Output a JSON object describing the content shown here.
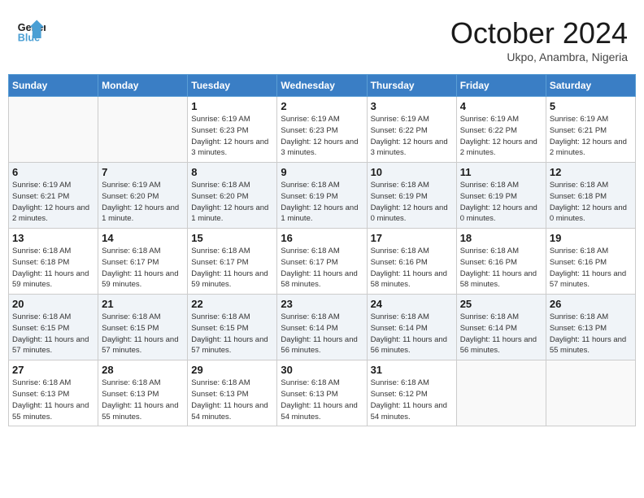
{
  "header": {
    "logo_line1": "General",
    "logo_line2": "Blue",
    "month": "October 2024",
    "location": "Ukpo, Anambra, Nigeria"
  },
  "weekdays": [
    "Sunday",
    "Monday",
    "Tuesday",
    "Wednesday",
    "Thursday",
    "Friday",
    "Saturday"
  ],
  "weeks": [
    [
      {
        "day": "",
        "info": ""
      },
      {
        "day": "",
        "info": ""
      },
      {
        "day": "1",
        "info": "Sunrise: 6:19 AM\nSunset: 6:23 PM\nDaylight: 12 hours\nand 3 minutes."
      },
      {
        "day": "2",
        "info": "Sunrise: 6:19 AM\nSunset: 6:23 PM\nDaylight: 12 hours\nand 3 minutes."
      },
      {
        "day": "3",
        "info": "Sunrise: 6:19 AM\nSunset: 6:22 PM\nDaylight: 12 hours\nand 3 minutes."
      },
      {
        "day": "4",
        "info": "Sunrise: 6:19 AM\nSunset: 6:22 PM\nDaylight: 12 hours\nand 2 minutes."
      },
      {
        "day": "5",
        "info": "Sunrise: 6:19 AM\nSunset: 6:21 PM\nDaylight: 12 hours\nand 2 minutes."
      }
    ],
    [
      {
        "day": "6",
        "info": "Sunrise: 6:19 AM\nSunset: 6:21 PM\nDaylight: 12 hours\nand 2 minutes."
      },
      {
        "day": "7",
        "info": "Sunrise: 6:19 AM\nSunset: 6:20 PM\nDaylight: 12 hours\nand 1 minute."
      },
      {
        "day": "8",
        "info": "Sunrise: 6:18 AM\nSunset: 6:20 PM\nDaylight: 12 hours\nand 1 minute."
      },
      {
        "day": "9",
        "info": "Sunrise: 6:18 AM\nSunset: 6:19 PM\nDaylight: 12 hours\nand 1 minute."
      },
      {
        "day": "10",
        "info": "Sunrise: 6:18 AM\nSunset: 6:19 PM\nDaylight: 12 hours\nand 0 minutes."
      },
      {
        "day": "11",
        "info": "Sunrise: 6:18 AM\nSunset: 6:19 PM\nDaylight: 12 hours\nand 0 minutes."
      },
      {
        "day": "12",
        "info": "Sunrise: 6:18 AM\nSunset: 6:18 PM\nDaylight: 12 hours\nand 0 minutes."
      }
    ],
    [
      {
        "day": "13",
        "info": "Sunrise: 6:18 AM\nSunset: 6:18 PM\nDaylight: 11 hours\nand 59 minutes."
      },
      {
        "day": "14",
        "info": "Sunrise: 6:18 AM\nSunset: 6:17 PM\nDaylight: 11 hours\nand 59 minutes."
      },
      {
        "day": "15",
        "info": "Sunrise: 6:18 AM\nSunset: 6:17 PM\nDaylight: 11 hours\nand 59 minutes."
      },
      {
        "day": "16",
        "info": "Sunrise: 6:18 AM\nSunset: 6:17 PM\nDaylight: 11 hours\nand 58 minutes."
      },
      {
        "day": "17",
        "info": "Sunrise: 6:18 AM\nSunset: 6:16 PM\nDaylight: 11 hours\nand 58 minutes."
      },
      {
        "day": "18",
        "info": "Sunrise: 6:18 AM\nSunset: 6:16 PM\nDaylight: 11 hours\nand 58 minutes."
      },
      {
        "day": "19",
        "info": "Sunrise: 6:18 AM\nSunset: 6:16 PM\nDaylight: 11 hours\nand 57 minutes."
      }
    ],
    [
      {
        "day": "20",
        "info": "Sunrise: 6:18 AM\nSunset: 6:15 PM\nDaylight: 11 hours\nand 57 minutes."
      },
      {
        "day": "21",
        "info": "Sunrise: 6:18 AM\nSunset: 6:15 PM\nDaylight: 11 hours\nand 57 minutes."
      },
      {
        "day": "22",
        "info": "Sunrise: 6:18 AM\nSunset: 6:15 PM\nDaylight: 11 hours\nand 57 minutes."
      },
      {
        "day": "23",
        "info": "Sunrise: 6:18 AM\nSunset: 6:14 PM\nDaylight: 11 hours\nand 56 minutes."
      },
      {
        "day": "24",
        "info": "Sunrise: 6:18 AM\nSunset: 6:14 PM\nDaylight: 11 hours\nand 56 minutes."
      },
      {
        "day": "25",
        "info": "Sunrise: 6:18 AM\nSunset: 6:14 PM\nDaylight: 11 hours\nand 56 minutes."
      },
      {
        "day": "26",
        "info": "Sunrise: 6:18 AM\nSunset: 6:13 PM\nDaylight: 11 hours\nand 55 minutes."
      }
    ],
    [
      {
        "day": "27",
        "info": "Sunrise: 6:18 AM\nSunset: 6:13 PM\nDaylight: 11 hours\nand 55 minutes."
      },
      {
        "day": "28",
        "info": "Sunrise: 6:18 AM\nSunset: 6:13 PM\nDaylight: 11 hours\nand 55 minutes."
      },
      {
        "day": "29",
        "info": "Sunrise: 6:18 AM\nSunset: 6:13 PM\nDaylight: 11 hours\nand 54 minutes."
      },
      {
        "day": "30",
        "info": "Sunrise: 6:18 AM\nSunset: 6:13 PM\nDaylight: 11 hours\nand 54 minutes."
      },
      {
        "day": "31",
        "info": "Sunrise: 6:18 AM\nSunset: 6:12 PM\nDaylight: 11 hours\nand 54 minutes."
      },
      {
        "day": "",
        "info": ""
      },
      {
        "day": "",
        "info": ""
      }
    ]
  ]
}
